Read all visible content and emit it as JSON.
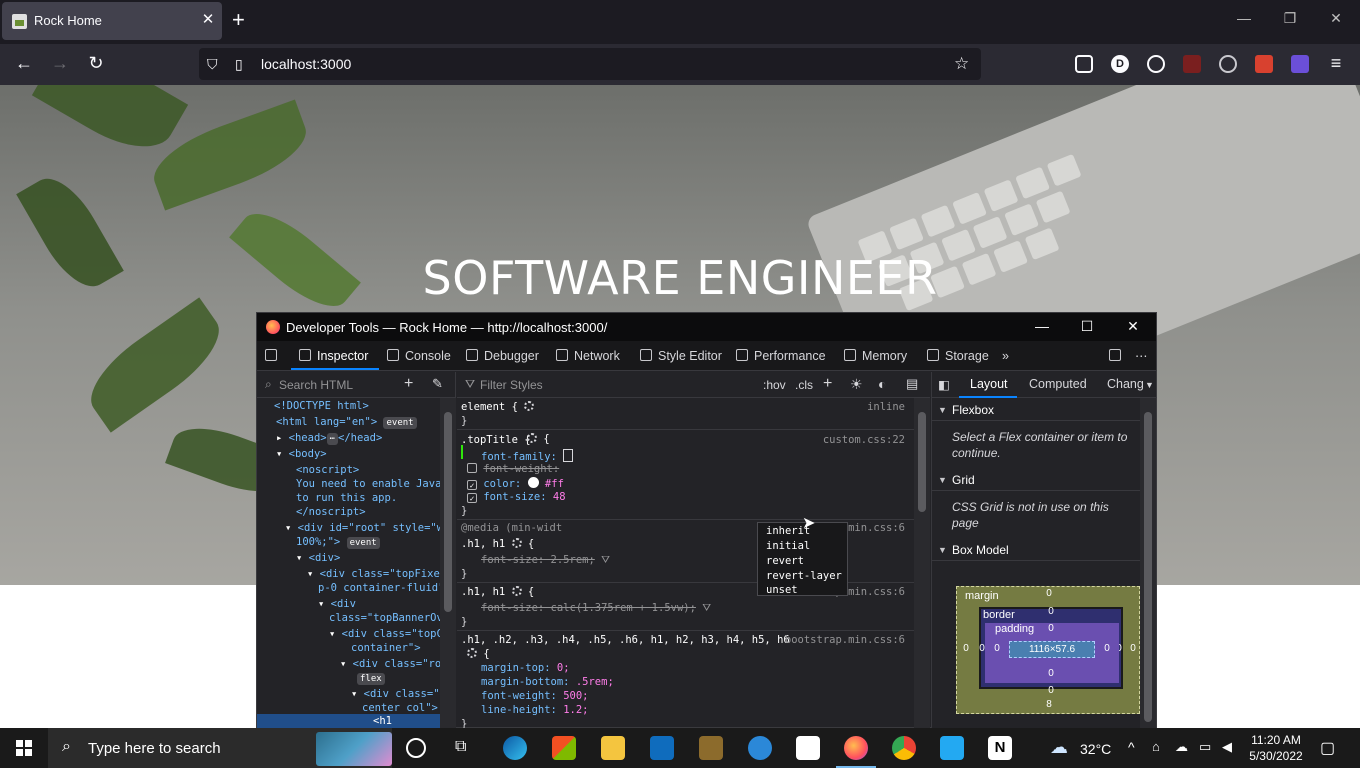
{
  "browser": {
    "tab_title": "Rock Home",
    "url": "localhost:3000"
  },
  "page": {
    "hero_title": "SOFTWARE ENGINEER"
  },
  "devtools": {
    "window_title": "Developer Tools — Rock Home — http://localhost:3000/",
    "tabs": [
      "Inspector",
      "Console",
      "Debugger",
      "Network",
      "Style Editor",
      "Performance",
      "Memory",
      "Storage"
    ],
    "search_html_placeholder": "Search HTML",
    "filter_styles_placeholder": "Filter Styles",
    "hov": ":hov",
    "cls": ".cls",
    "tree": {
      "doctype": "<!DOCTYPE html>",
      "html_open": "<html lang=\"en\">",
      "head": "<head>",
      "head_close": "</head>",
      "body": "<body>",
      "noscript": "<noscript>",
      "noscript_text1": "You need to enable JavaS",
      "noscript_text2": "to run this app.",
      "noscript_close": "</noscript>",
      "div_root1": "<div id=\"root\" style=\"wi",
      "div_root2": "100%;\">",
      "div": "<div>",
      "div_topfixed1": "<div class=\"topFixedN",
      "div_topfixed2": "p-0 container-fluid\">",
      "div_banner1": "<div",
      "div_banner2": "class=\"topBannerOve",
      "div_topco1": "<div class=\"topCo",
      "div_topco2": "container\">",
      "div_row": "<div class=\"row",
      "div_col1": "<div class=\"t",
      "div_col2": "center col\">",
      "h1": "<h1",
      "badge_event": "event",
      "badge_flex": "flex"
    },
    "rules": {
      "element": "element {",
      "inline": "inline",
      "toptitle": ".topTitle {",
      "toptitle_src": "custom.css:22",
      "font_family": "font-family:",
      "font_weight": "font-weight:",
      "color": "color:",
      "color_val": "#ff",
      "font_size": "font-size:",
      "font_size_val": "48",
      "media": "@media (min-widt",
      "h1_sel": ".h1, h1",
      "bootstrap_src": "bootstrap.min.css:6",
      "fs_25": "font-size: 2.5rem;",
      "fs_calc": "font-size: calc(1.375rem + 1.5vw);",
      "heading_sel": ".h1, .h2, .h3, .h4, .h5, .h6, h1, h2, h3, h4, h5, h6",
      "margin_top": "margin-top:",
      "margin_top_val": "0;",
      "margin_bottom": "margin-bottom:",
      "margin_bottom_val": ".5rem;",
      "fw500": "font-weight:",
      "fw500_val": "500;",
      "line_height": "line-height:",
      "line_height_val": "1.2;",
      "close": "}",
      "open": "{"
    },
    "autocomplete": [
      "inherit",
      "initial",
      "revert",
      "revert-layer",
      "unset"
    ],
    "layout_tabs": [
      "Layout",
      "Computed",
      "Chang"
    ],
    "flexbox_title": "Flexbox",
    "flexbox_note": "Select a Flex container or item to continue.",
    "grid_title": "Grid",
    "grid_note": "CSS Grid is not in use on this page",
    "boxmodel_title": "Box Model",
    "boxmodel": {
      "margin": "margin",
      "border": "border",
      "padding": "padding",
      "content": "1116×57.6",
      "zero": "0",
      "margin_bottom": "8"
    }
  },
  "taskbar": {
    "search_placeholder": "Type here to search",
    "temperature": "32°C",
    "time": "11:20 AM",
    "date": "5/30/2022"
  }
}
